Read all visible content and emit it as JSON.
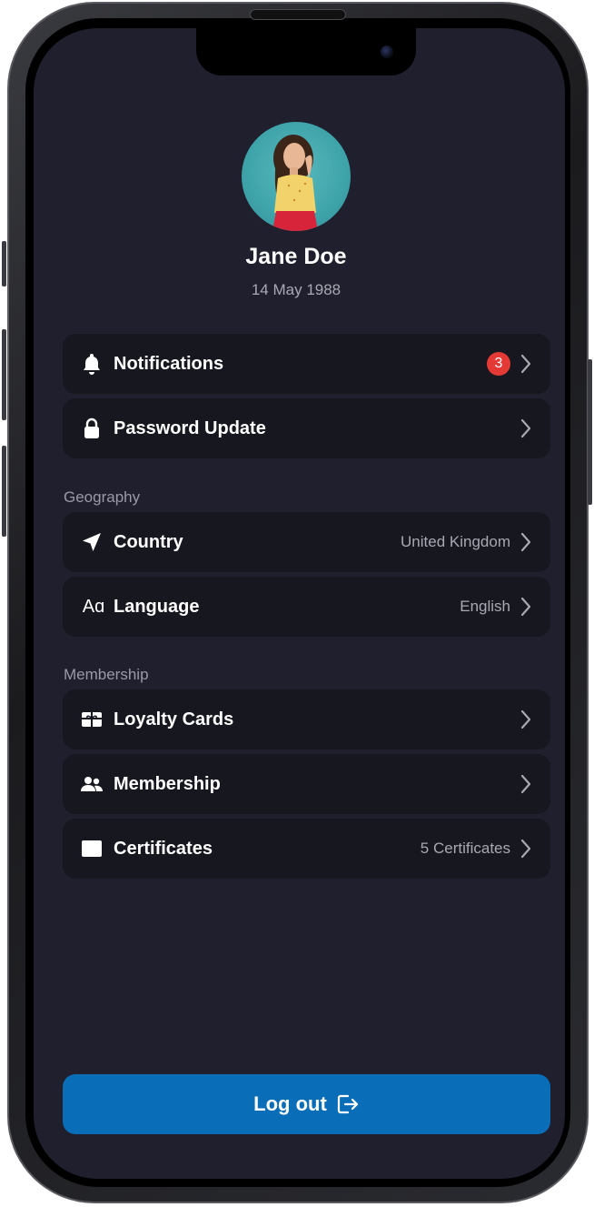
{
  "profile": {
    "name": "Jane Doe",
    "dob": "14 May 1988"
  },
  "rows": {
    "notifications": {
      "label": "Notifications",
      "badge": "3",
      "icon": "bell-icon"
    },
    "password": {
      "label": "Password Update",
      "icon": "lock-icon"
    },
    "country": {
      "label": "Country",
      "value": "United Kingdom",
      "icon": "location-arrow-icon"
    },
    "language": {
      "label": "Language",
      "value": "English",
      "icon": "language-icon",
      "icon_text": "Aɑ"
    },
    "loyalty": {
      "label": "Loyalty Cards",
      "icon": "gift-card-icon"
    },
    "membership": {
      "label": "Membership",
      "icon": "people-icon"
    },
    "certificates": {
      "label": "Certificates",
      "value": "5 Certificates",
      "icon": "certificate-icon"
    }
  },
  "sections": {
    "geography": "Geography",
    "membership": "Membership"
  },
  "logout": {
    "label": "Log out",
    "icon": "logout-icon"
  },
  "colors": {
    "screen_bg": "#1f1f2e",
    "row_bg": "#17171f",
    "accent": "#0a6db8",
    "badge": "#e53935"
  }
}
